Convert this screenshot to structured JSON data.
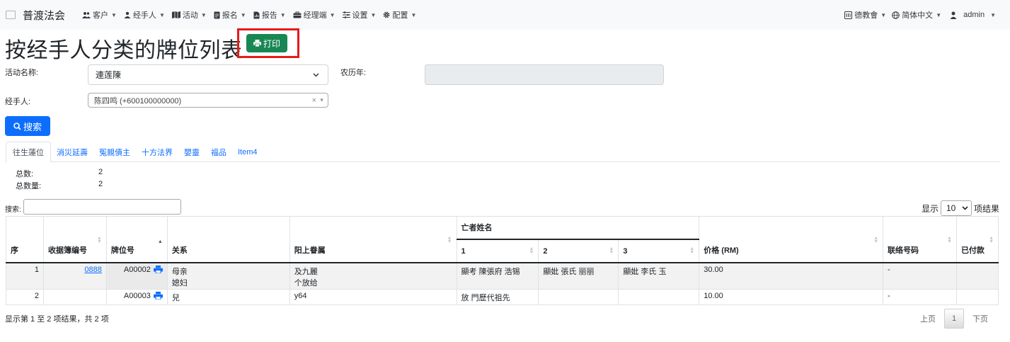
{
  "navbar": {
    "brand": "普渡法会",
    "menu": [
      {
        "icon": "users-icon",
        "label": "客户"
      },
      {
        "icon": "person-icon",
        "label": "经手人"
      },
      {
        "icon": "map-icon",
        "label": "活动"
      },
      {
        "icon": "document-icon",
        "label": "报名"
      },
      {
        "icon": "report-icon",
        "label": "报告"
      },
      {
        "icon": "briefcase-icon",
        "label": "经理端"
      },
      {
        "icon": "settings-list-icon",
        "label": "设置"
      },
      {
        "icon": "gear-icon",
        "label": "配置"
      }
    ],
    "right": [
      {
        "icon": "building-icon",
        "label": "德教會"
      },
      {
        "icon": "globe-icon",
        "label": "简体中文"
      },
      {
        "icon": "user-icon",
        "label": "admin"
      }
    ]
  },
  "page": {
    "title": "按经手人分类的牌位列表",
    "print_label": "打印"
  },
  "form": {
    "event_label": "活动名称:",
    "event_value": "連莲陳",
    "lunar_label": "农历年:",
    "lunar_value": "",
    "agent_label": "经手人:",
    "agent_value": "陈四鸣 (+600100000000)",
    "agent_clear": "×",
    "search_label": "搜索"
  },
  "tabs": [
    "往生蓮位",
    "消災延壽",
    "冤親債主",
    "十方法界",
    "嬰靈",
    "福品",
    "Item4"
  ],
  "stats": {
    "total_label": "总数:",
    "total_value": "2",
    "qty_label": "总数量:",
    "qty_value": "2"
  },
  "table_controls": {
    "search_label": "搜索:",
    "length_prefix": "显示",
    "length_value": "10",
    "length_suffix": "项结果"
  },
  "table": {
    "headers": {
      "seq": "序",
      "receipt": "收据簿编号",
      "tablet": "牌位号",
      "relation": "关系",
      "living": "阳上眷属",
      "deceased_group": "亡者姓名",
      "d1": "1",
      "d2": "2",
      "d3": "3",
      "price": "价格 (RM)",
      "contact": "联络号码",
      "paid": "已付款"
    },
    "rows": [
      {
        "seq": "1",
        "receipt": "0888",
        "tablet": "A00002",
        "relation_1": "母亲",
        "relation_2": "媳妇",
        "living_1": "及九麗",
        "living_2": "个放给",
        "d1": "顯考 陳張府 浩锡",
        "d2": "顯妣 張氏 丽丽",
        "d3": "顯妣 李氏 玉",
        "price": "30.00",
        "contact": "-",
        "paid": ""
      },
      {
        "seq": "2",
        "receipt": "",
        "tablet": "A00003",
        "relation_1": "兒",
        "relation_2": "",
        "living_1": "y64",
        "living_2": "",
        "d1": "放 門歷代祖先",
        "d2": "",
        "d3": "",
        "price": "10.00",
        "contact": "-",
        "paid": ""
      }
    ]
  },
  "footer": {
    "info": "显示第 1 至 2 项结果，共 2 项",
    "prev": "上页",
    "page": "1",
    "next": "下页"
  },
  "colors": {
    "primary": "#0d6efd",
    "success": "#198754",
    "highlight_border": "#e31b1b"
  }
}
